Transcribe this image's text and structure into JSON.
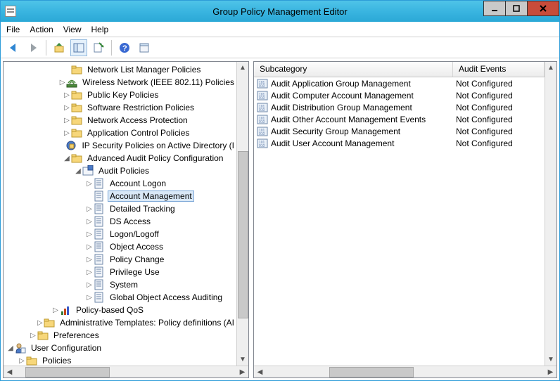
{
  "window": {
    "title": "Group Policy Management Editor"
  },
  "menu": {
    "file": "File",
    "action": "Action",
    "view": "View",
    "help": "Help"
  },
  "tree": {
    "items": [
      {
        "indent": 5,
        "caret": "",
        "icon": "folder",
        "label": "Network List Manager Policies"
      },
      {
        "indent": 5,
        "caret": "▷",
        "icon": "wifi",
        "label": "Wireless Network (IEEE 802.11) Policies"
      },
      {
        "indent": 5,
        "caret": "▷",
        "icon": "folder",
        "label": "Public Key Policies"
      },
      {
        "indent": 5,
        "caret": "▷",
        "icon": "folder",
        "label": "Software Restriction Policies"
      },
      {
        "indent": 5,
        "caret": "▷",
        "icon": "folder",
        "label": "Network Access Protection"
      },
      {
        "indent": 5,
        "caret": "▷",
        "icon": "folder",
        "label": "Application Control Policies"
      },
      {
        "indent": 5,
        "caret": "",
        "icon": "ipsec",
        "label": "IP Security Policies on Active Directory (I"
      },
      {
        "indent": 5,
        "caret": "◢",
        "icon": "folder",
        "label": "Advanced Audit Policy Configuration"
      },
      {
        "indent": 6,
        "caret": "◢",
        "icon": "auditroot",
        "label": "Audit Policies"
      },
      {
        "indent": 7,
        "caret": "▷",
        "icon": "policy",
        "label": "Account Logon"
      },
      {
        "indent": 7,
        "caret": "",
        "icon": "policy",
        "label": "Account Management",
        "selected": true
      },
      {
        "indent": 7,
        "caret": "▷",
        "icon": "policy",
        "label": "Detailed Tracking"
      },
      {
        "indent": 7,
        "caret": "▷",
        "icon": "policy",
        "label": "DS Access"
      },
      {
        "indent": 7,
        "caret": "▷",
        "icon": "policy",
        "label": "Logon/Logoff"
      },
      {
        "indent": 7,
        "caret": "▷",
        "icon": "policy",
        "label": "Object Access"
      },
      {
        "indent": 7,
        "caret": "▷",
        "icon": "policy",
        "label": "Policy Change"
      },
      {
        "indent": 7,
        "caret": "▷",
        "icon": "policy",
        "label": "Privilege Use"
      },
      {
        "indent": 7,
        "caret": "▷",
        "icon": "policy",
        "label": "System"
      },
      {
        "indent": 7,
        "caret": "▷",
        "icon": "policy",
        "label": "Global Object Access Auditing"
      },
      {
        "indent": 4,
        "caret": "▷",
        "icon": "qos",
        "label": "Policy-based QoS"
      },
      {
        "indent": 3,
        "caret": "▷",
        "icon": "folder",
        "label": "Administrative Templates: Policy definitions (AI"
      },
      {
        "indent": 2,
        "caret": "▷",
        "icon": "folder",
        "label": "Preferences"
      },
      {
        "indent": 0,
        "caret": "◢",
        "icon": "userconf",
        "label": "User Configuration"
      },
      {
        "indent": 1,
        "caret": "▷",
        "icon": "folder",
        "label": "Policies"
      }
    ]
  },
  "list": {
    "columns": {
      "subcategory": "Subcategory",
      "auditevents": "Audit Events"
    },
    "rows": [
      {
        "sub": "Audit Application Group Management",
        "ae": "Not Configured"
      },
      {
        "sub": "Audit Computer Account Management",
        "ae": "Not Configured"
      },
      {
        "sub": "Audit Distribution Group Management",
        "ae": "Not Configured"
      },
      {
        "sub": "Audit Other Account Management Events",
        "ae": "Not Configured"
      },
      {
        "sub": "Audit Security Group Management",
        "ae": "Not Configured"
      },
      {
        "sub": "Audit User Account Management",
        "ae": "Not Configured"
      }
    ]
  }
}
